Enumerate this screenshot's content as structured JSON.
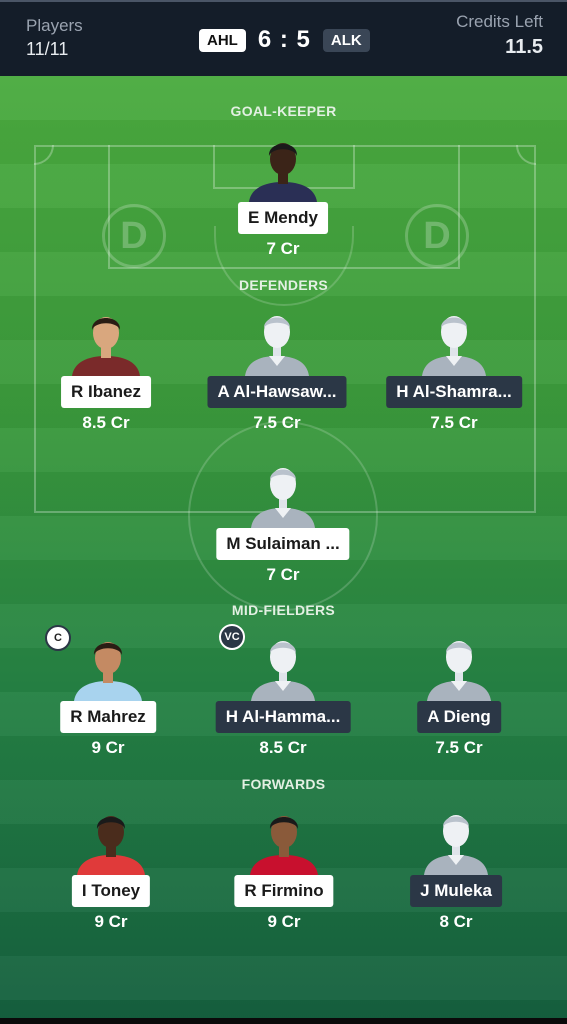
{
  "header": {
    "players_label": "Players",
    "players_value": "11/11",
    "home_team": "AHL",
    "score": "6 : 5",
    "away_team": "ALK",
    "credits_label": "Credits Left",
    "credits_value": "11.5"
  },
  "sections": {
    "goalkeeper": "GOAL-KEEPER",
    "defenders": "DEFENDERS",
    "midfielders": "MID-FIELDERS",
    "forwards": "FORWARDS"
  },
  "field_logo_letter": "D",
  "players": {
    "gk1": {
      "name": "E Mendy",
      "credits": "7 Cr",
      "tag": "light",
      "photo": "player-photo"
    },
    "def1": {
      "name": "R Ibanez",
      "credits": "8.5 Cr",
      "tag": "light",
      "photo": "player-photo"
    },
    "def2": {
      "name": "A Al-Hawsaw...",
      "credits": "7.5 Cr",
      "tag": "dark",
      "photo": "placeholder-avatar"
    },
    "def3": {
      "name": "H Al-Shamra...",
      "credits": "7.5 Cr",
      "tag": "dark",
      "photo": "placeholder-avatar"
    },
    "def4": {
      "name": "M Sulaiman ...",
      "credits": "7 Cr",
      "tag": "light",
      "photo": "placeholder-avatar"
    },
    "mid1": {
      "name": "R Mahrez",
      "credits": "9 Cr",
      "tag": "light",
      "photo": "player-photo",
      "badge": "C"
    },
    "mid2": {
      "name": "H Al-Hamma...",
      "credits": "8.5 Cr",
      "tag": "dark",
      "photo": "placeholder-avatar",
      "badge": "VC"
    },
    "mid3": {
      "name": "A Dieng",
      "credits": "7.5 Cr",
      "tag": "dark",
      "photo": "placeholder-avatar"
    },
    "fwd1": {
      "name": "I Toney",
      "credits": "9 Cr",
      "tag": "light",
      "photo": "player-photo"
    },
    "fwd2": {
      "name": "R Firmino",
      "credits": "9 Cr",
      "tag": "light",
      "photo": "player-photo"
    },
    "fwd3": {
      "name": "J Muleka",
      "credits": "8 Cr",
      "tag": "dark",
      "photo": "placeholder-avatar"
    }
  },
  "colors": {
    "header_bg": "#141d29",
    "field_top": "#4bab3f",
    "field_bottom": "#15603f",
    "dark_tag": "#2b3746"
  }
}
